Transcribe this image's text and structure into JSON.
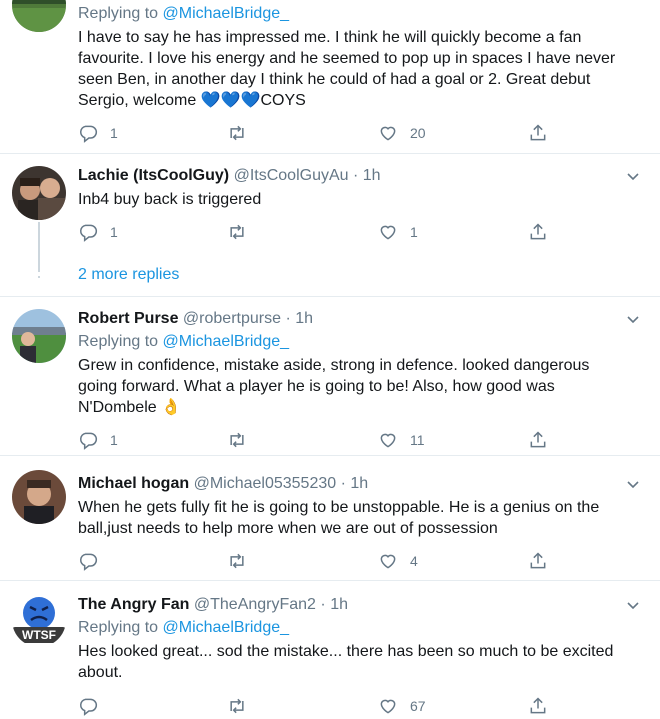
{
  "tweets": [
    {
      "replying_prefix": "Replying to",
      "replying_to": "@MichaelBridge_",
      "text_lines": [
        "I have to say he has impressed me. I think he will quickly become a fan",
        "favourite. I love his energy and he seemed to pop up in spaces I have never",
        "seen Ben, in another day I think he could of had a goal or 2. Great debut",
        "Sergio, welcome 💙💙💙COYS"
      ],
      "replies": "1",
      "retweets": "",
      "likes": "20"
    },
    {
      "name": "Lachie (ItsCoolGuy)",
      "handle": "@ItsCoolGuyAu",
      "sep": "·",
      "time": "1h",
      "text_lines": [
        "Inb4 buy back is triggered"
      ],
      "replies": "1",
      "retweets": "",
      "likes": "1"
    },
    {
      "name": "Robert Purse",
      "handle": "@robertpurse",
      "sep": "·",
      "time": "1h",
      "replying_prefix": "Replying to",
      "replying_to": "@MichaelBridge_",
      "text_lines": [
        "Grew in confidence, mistake aside, strong in defence. looked dangerous",
        "going forward. What  a player he is going to be! Also, how good was",
        "N'Dombele 👌"
      ],
      "replies": "1",
      "retweets": "",
      "likes": "11"
    },
    {
      "name": "Michael hogan",
      "handle": "@Michael05355230",
      "sep": "·",
      "time": "1h",
      "text_lines": [
        "When he gets fully fit he is going to be unstoppable. He is a genius on the",
        "ball,just needs to help more when we are out of possession"
      ],
      "replies": "",
      "retweets": "",
      "likes": "4"
    },
    {
      "name": "The Angry Fan",
      "handle": "@TheAngryFan2",
      "sep": "·",
      "time": "1h",
      "replying_prefix": "Replying to",
      "replying_to": "@MichaelBridge_",
      "text_lines": [
        "Hes looked great... sod the mistake... there has been so much to be excited",
        "about."
      ],
      "avatar_badge": "WTSF",
      "replies": "",
      "retweets": "",
      "likes": "67"
    }
  ],
  "more_replies": "2 more replies",
  "colors": {
    "accent": "#1b95e0",
    "muted": "#657786",
    "divider": "#e6ecf0",
    "text": "#14171a"
  },
  "icons": [
    "reply-icon",
    "retweet-icon",
    "like-icon",
    "share-icon",
    "chevron-down-icon"
  ]
}
